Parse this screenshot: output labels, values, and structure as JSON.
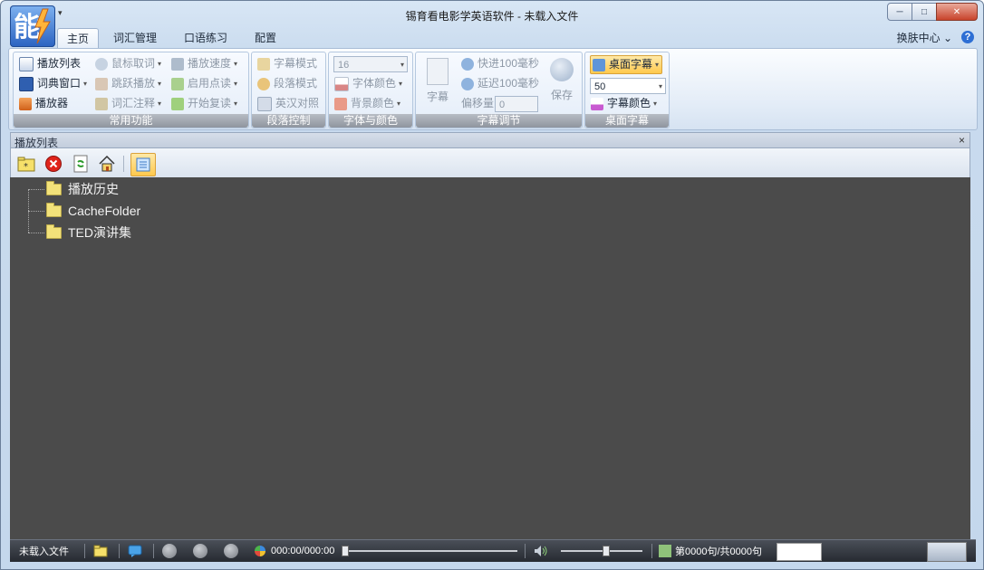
{
  "window": {
    "title": "锡育看电影学英语软件 - 未载入文件",
    "controls": {
      "minimize": "─",
      "maximize": "□",
      "close": "✕"
    },
    "quick_access": "▾"
  },
  "tabs": [
    {
      "label": "主页",
      "active": true
    },
    {
      "label": "词汇管理",
      "active": false
    },
    {
      "label": "口语练习",
      "active": false
    },
    {
      "label": "配置",
      "active": false
    }
  ],
  "topright": {
    "skin": "换肤中心",
    "skin_arrow": "⌄",
    "help": "?"
  },
  "ribbon": {
    "common": {
      "label": "常用功能",
      "col1": [
        "播放列表",
        "词典窗口",
        "播放器"
      ],
      "col2": [
        "鼠标取词",
        "跳跃播放",
        "词汇注释"
      ],
      "col3": [
        "播放速度",
        "启用点读",
        "开始复读"
      ]
    },
    "paragraph": {
      "label": "段落控制",
      "items": [
        "字幕模式",
        "段落模式",
        "英汉对照"
      ]
    },
    "font": {
      "label": "字体与颜色",
      "size": "16",
      "items": [
        "字体颜色",
        "背景颜色"
      ]
    },
    "subtitle": {
      "label": "字幕调节",
      "big_button": "字幕",
      "forward": "快进100毫秒",
      "delay": "延迟100毫秒",
      "offset_label": "偏移量",
      "offset_value": "0",
      "save": "保存"
    },
    "desktop": {
      "label": "桌面字幕",
      "toggle": "桌面字幕",
      "size": "50",
      "color": "字幕颜色"
    }
  },
  "panel": {
    "title": "播放列表",
    "close": "×",
    "toolbar_icons": [
      "add-folder-icon",
      "delete-icon",
      "refresh-icon",
      "home-icon",
      "list-view-icon"
    ],
    "tree": [
      "播放历史",
      "CacheFolder",
      "TED演讲集"
    ]
  },
  "statusbar": {
    "file": "未载入文件",
    "time": "000:00/000:00",
    "sentence": "第0000句/共0000句"
  },
  "colors": {
    "accent": "#2e6fd4",
    "tree_bg": "#4b4b4b",
    "status_bg": "#2f333a",
    "highlight": "#ffc94d"
  }
}
